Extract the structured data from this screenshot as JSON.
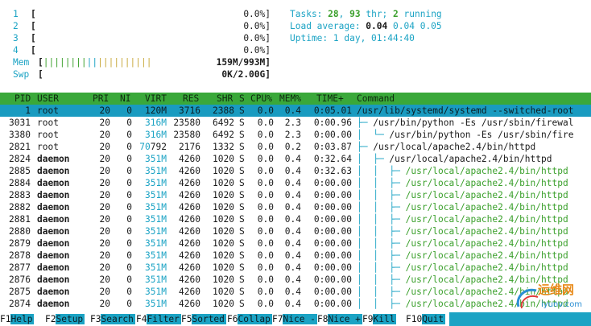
{
  "meters": [
    {
      "num": "1",
      "bracket": "[",
      "value": "0.0%]"
    },
    {
      "num": "2",
      "bracket": "[",
      "value": "0.0%]"
    },
    {
      "num": "3",
      "bracket": "[",
      "value": "0.0%]"
    },
    {
      "num": "4",
      "bracket": "[",
      "value": "0.0%]"
    }
  ],
  "mem": {
    "label": "Mem",
    "bar": "[||||||||||||||||||||",
    "value": "159M/993M]"
  },
  "swp": {
    "label": "Swp",
    "bar": "[",
    "value": "0K/2.00G]"
  },
  "stats": {
    "tasks_label": "Tasks: ",
    "tasks_count": "28",
    "tasks_sep": ", ",
    "threads": "93",
    "thr_label": " thr; ",
    "running": "2",
    "running_label": " running",
    "load_label": "Load average: ",
    "load1": "0.04",
    "load5": "0.04",
    "load15": "0.05",
    "uptime_label": "Uptime: ",
    "uptime": "1 day, 01:44:40"
  },
  "columns": [
    "PID",
    "USER",
    "PRI",
    "NI",
    "VIRT",
    "RES",
    "SHR",
    "S",
    "CPU%",
    "MEM%",
    "TIME+",
    "Command"
  ],
  "processes": [
    {
      "pid": "1",
      "user": "root",
      "pri": "20",
      "ni": "0",
      "virt": "120M",
      "res": "3716",
      "shr": "2388",
      "s": "S",
      "cpu": "0.0",
      "mem": "0.4",
      "time": "0:05.01",
      "tree": "",
      "cmd": "/usr/lib/systemd/systemd --switched-root"
    },
    {
      "pid": "3031",
      "user": "root",
      "pri": "20",
      "ni": "0",
      "virt": "316M",
      "res": "23580",
      "shr": "6492",
      "s": "S",
      "cpu": "0.0",
      "mem": "2.3",
      "time": "0:00.96",
      "tree": "├─ ",
      "cmd": "/usr/bin/python -Es /usr/sbin/firewal"
    },
    {
      "pid": "3380",
      "user": "root",
      "pri": "20",
      "ni": "0",
      "virt": "316M",
      "res": "23580",
      "shr": "6492",
      "s": "S",
      "cpu": "0.0",
      "mem": "2.3",
      "time": "0:00.00",
      "tree": "│  └─ ",
      "cmd": "/usr/bin/python -Es /usr/sbin/fire"
    },
    {
      "pid": "2821",
      "user": "root",
      "pri": "20",
      "ni": "0",
      "virt": "70792",
      "res": "2176",
      "shr": "1332",
      "s": "S",
      "cpu": "0.0",
      "mem": "0.2",
      "time": "0:03.87",
      "tree": "├─ ",
      "cmd": "/usr/local/apache2.4/bin/httpd"
    },
    {
      "pid": "2824",
      "user": "daemon",
      "pri": "20",
      "ni": "0",
      "virt": "351M",
      "res": "4260",
      "shr": "1020",
      "s": "S",
      "cpu": "0.0",
      "mem": "0.4",
      "time": "0:32.64",
      "tree": "│  ├─ ",
      "cmd": "/usr/local/apache2.4/bin/httpd"
    },
    {
      "pid": "2885",
      "user": "daemon",
      "pri": "20",
      "ni": "0",
      "virt": "351M",
      "res": "4260",
      "shr": "1020",
      "s": "S",
      "cpu": "0.0",
      "mem": "0.4",
      "time": "0:32.63",
      "tree": "│  │  ├─ ",
      "cmd": "/usr/local/apache2.4/bin/httpd"
    },
    {
      "pid": "2884",
      "user": "daemon",
      "pri": "20",
      "ni": "0",
      "virt": "351M",
      "res": "4260",
      "shr": "1020",
      "s": "S",
      "cpu": "0.0",
      "mem": "0.4",
      "time": "0:00.00",
      "tree": "│  │  ├─ ",
      "cmd": "/usr/local/apache2.4/bin/httpd"
    },
    {
      "pid": "2883",
      "user": "daemon",
      "pri": "20",
      "ni": "0",
      "virt": "351M",
      "res": "4260",
      "shr": "1020",
      "s": "S",
      "cpu": "0.0",
      "mem": "0.4",
      "time": "0:00.00",
      "tree": "│  │  ├─ ",
      "cmd": "/usr/local/apache2.4/bin/httpd"
    },
    {
      "pid": "2882",
      "user": "daemon",
      "pri": "20",
      "ni": "0",
      "virt": "351M",
      "res": "4260",
      "shr": "1020",
      "s": "S",
      "cpu": "0.0",
      "mem": "0.4",
      "time": "0:00.00",
      "tree": "│  │  ├─ ",
      "cmd": "/usr/local/apache2.4/bin/httpd"
    },
    {
      "pid": "2881",
      "user": "daemon",
      "pri": "20",
      "ni": "0",
      "virt": "351M",
      "res": "4260",
      "shr": "1020",
      "s": "S",
      "cpu": "0.0",
      "mem": "0.4",
      "time": "0:00.00",
      "tree": "│  │  ├─ ",
      "cmd": "/usr/local/apache2.4/bin/httpd"
    },
    {
      "pid": "2880",
      "user": "daemon",
      "pri": "20",
      "ni": "0",
      "virt": "351M",
      "res": "4260",
      "shr": "1020",
      "s": "S",
      "cpu": "0.0",
      "mem": "0.4",
      "time": "0:00.00",
      "tree": "│  │  ├─ ",
      "cmd": "/usr/local/apache2.4/bin/httpd"
    },
    {
      "pid": "2879",
      "user": "daemon",
      "pri": "20",
      "ni": "0",
      "virt": "351M",
      "res": "4260",
      "shr": "1020",
      "s": "S",
      "cpu": "0.0",
      "mem": "0.4",
      "time": "0:00.00",
      "tree": "│  │  ├─ ",
      "cmd": "/usr/local/apache2.4/bin/httpd"
    },
    {
      "pid": "2878",
      "user": "daemon",
      "pri": "20",
      "ni": "0",
      "virt": "351M",
      "res": "4260",
      "shr": "1020",
      "s": "S",
      "cpu": "0.0",
      "mem": "0.4",
      "time": "0:00.00",
      "tree": "│  │  ├─ ",
      "cmd": "/usr/local/apache2.4/bin/httpd"
    },
    {
      "pid": "2877",
      "user": "daemon",
      "pri": "20",
      "ni": "0",
      "virt": "351M",
      "res": "4260",
      "shr": "1020",
      "s": "S",
      "cpu": "0.0",
      "mem": "0.4",
      "time": "0:00.00",
      "tree": "│  │  ├─ ",
      "cmd": "/usr/local/apache2.4/bin/httpd"
    },
    {
      "pid": "2876",
      "user": "daemon",
      "pri": "20",
      "ni": "0",
      "virt": "351M",
      "res": "4260",
      "shr": "1020",
      "s": "S",
      "cpu": "0.0",
      "mem": "0.4",
      "time": "0:00.00",
      "tree": "│  │  ├─ ",
      "cmd": "/usr/local/apache2.4/bin/httpd"
    },
    {
      "pid": "2875",
      "user": "daemon",
      "pri": "20",
      "ni": "0",
      "virt": "351M",
      "res": "4260",
      "shr": "1020",
      "s": "S",
      "cpu": "0.0",
      "mem": "0.4",
      "time": "0:00.00",
      "tree": "│  │  ├─ ",
      "cmd": "/usr/local/apache2.4/bin/httpd"
    },
    {
      "pid": "2874",
      "user": "daemon",
      "pri": "20",
      "ni": "0",
      "virt": "351M",
      "res": "4260",
      "shr": "1020",
      "s": "S",
      "cpu": "0.0",
      "mem": "0.4",
      "time": "0:00.00",
      "tree": "│  │  ├─ ",
      "cmd": "/usr/local/apache2.4/bin/httpd"
    }
  ],
  "function_keys": [
    {
      "key": "F1",
      "label": "Help"
    },
    {
      "key": "F2",
      "label": "Setup"
    },
    {
      "key": "F3",
      "label": "Search"
    },
    {
      "key": "F4",
      "label": "Filter"
    },
    {
      "key": "F5",
      "label": "Sorted"
    },
    {
      "key": "F6",
      "label": "Collap"
    },
    {
      "key": "F7",
      "label": "Nice -"
    },
    {
      "key": "F8",
      "label": "Nice +"
    },
    {
      "key": "F9",
      "label": "Kill"
    },
    {
      "key": "F10",
      "label": "Quit"
    }
  ],
  "watermark": {
    "text": "运维网",
    "sub": "iyunv.com"
  },
  "colors": {
    "header_bg": "#3aa83a",
    "selected_bg": "#199bc0",
    "accent_cyan": "#1ba3c4",
    "accent_green": "#3ba02c"
  }
}
